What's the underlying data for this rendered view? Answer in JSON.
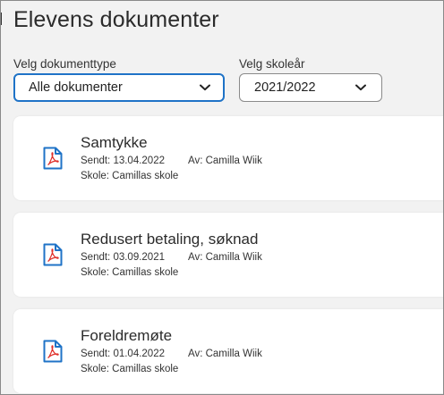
{
  "page": {
    "title": "Elevens dokumenter"
  },
  "filters": {
    "doctype_label": "Velg dokumenttype",
    "doctype_value": "Alle dokumenter",
    "year_label": "Velg skoleår",
    "year_value": "2021/2022"
  },
  "documents": [
    {
      "title": "Samtykke",
      "sent": "Sendt: 13.04.2022",
      "by": "Av: Camilla Wiik",
      "school": "Skole: Camillas skole",
      "icon": "pdf-icon"
    },
    {
      "title": "Redusert betaling, søknad",
      "sent": "Sendt: 03.09.2021",
      "by": "Av: Camilla Wiik",
      "school": "Skole: Camillas skole",
      "icon": "pdf-icon"
    },
    {
      "title": "Foreldremøte",
      "sent": "Sendt: 01.04.2022",
      "by": "Av: Camilla Wiik",
      "school": "Skole: Camillas skole",
      "icon": "pdf-icon"
    }
  ],
  "colors": {
    "accent": "#1f73c7",
    "pdf_red": "#e0302a",
    "page_bg": "#f2f2f2"
  }
}
